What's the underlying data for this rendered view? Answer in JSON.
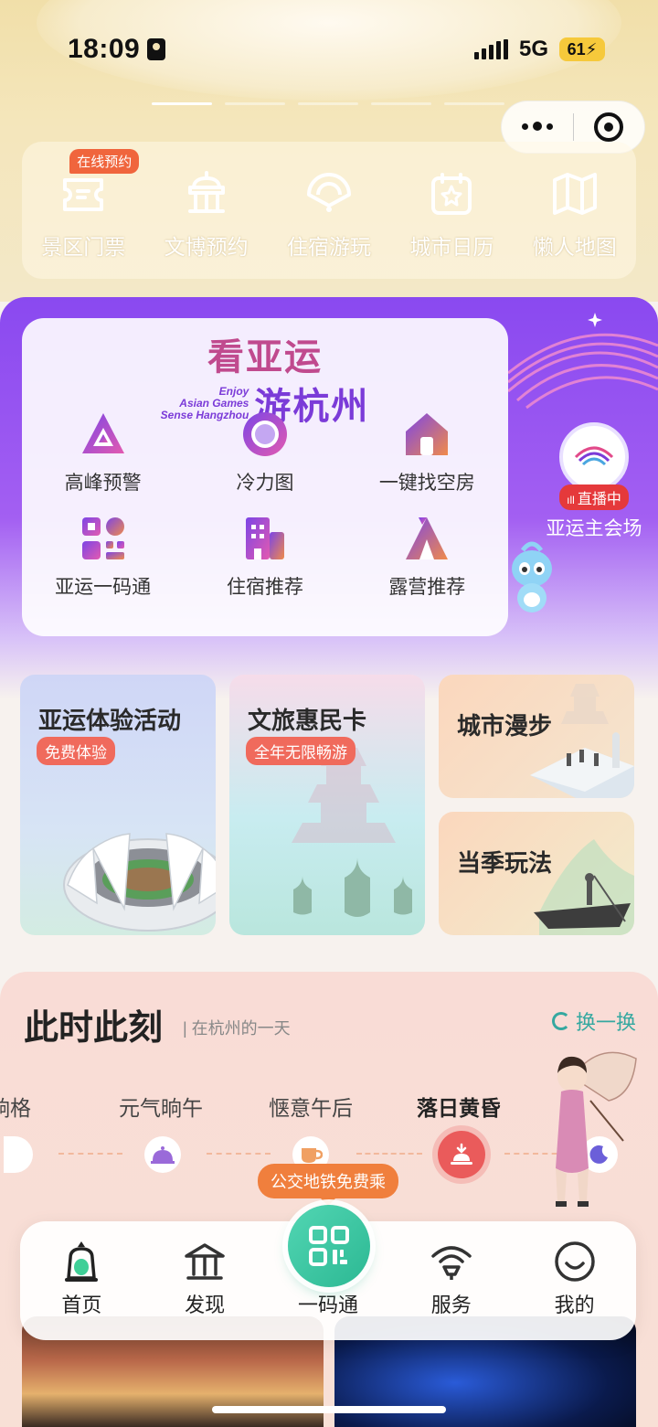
{
  "status_bar": {
    "time": "18:09",
    "network": "5G",
    "battery": "61"
  },
  "quick_nav": {
    "badge": "在线预约",
    "items": [
      {
        "label": "景区门票",
        "icon": "ticket-icon"
      },
      {
        "label": "文博预约",
        "icon": "museum-icon"
      },
      {
        "label": "住宿游玩",
        "icon": "fan-icon"
      },
      {
        "label": "城市日历",
        "icon": "calendar-icon"
      },
      {
        "label": "懒人地图",
        "icon": "map-icon"
      }
    ]
  },
  "asian_games": {
    "logo_cn_1": "看亚运",
    "logo_cn_2": "游杭州",
    "logo_en_1": "Enjoy",
    "logo_en_2": "Asian Games",
    "logo_en_3": "Sense Hangzhou",
    "items": [
      {
        "label": "高峰预警",
        "icon": "triangle-warning-icon"
      },
      {
        "label": "冷力图",
        "icon": "ring-icon"
      },
      {
        "label": "一键找空房",
        "icon": "house-icon"
      },
      {
        "label": "亚运一码通",
        "icon": "qr-code-icon"
      },
      {
        "label": "住宿推荐",
        "icon": "building-icon"
      },
      {
        "label": "露营推荐",
        "icon": "tent-icon"
      }
    ],
    "live_badge": "直播中",
    "live_name": "亚运主会场"
  },
  "feature_cards": [
    {
      "title": "亚运体验活动",
      "tag": "免费体验"
    },
    {
      "title": "文旅惠民卡",
      "tag": "全年无限畅游"
    },
    {
      "title": "城市漫步"
    },
    {
      "title": "当季玩法"
    }
  ],
  "moment": {
    "title": "此时此刻",
    "subtitle": "| 在杭州的一天",
    "refresh": "换一换",
    "timeline": [
      "晌格",
      "元气晌午",
      "惬意午后",
      "落日黄昏"
    ],
    "active": "落日黄昏"
  },
  "promo": "公交地铁免费乘",
  "bottom_nav": [
    {
      "label": "首页",
      "icon": "home-icon"
    },
    {
      "label": "发现",
      "icon": "discover-icon"
    },
    {
      "label": "一码通",
      "icon": "qr-code-icon"
    },
    {
      "label": "服务",
      "icon": "service-icon"
    },
    {
      "label": "我的",
      "icon": "profile-icon"
    }
  ],
  "colors": {
    "accent_purple": "#8a49f0",
    "accent_green": "#2cb893",
    "accent_orange": "#f07f3d",
    "active_red": "#ea5b5b"
  }
}
